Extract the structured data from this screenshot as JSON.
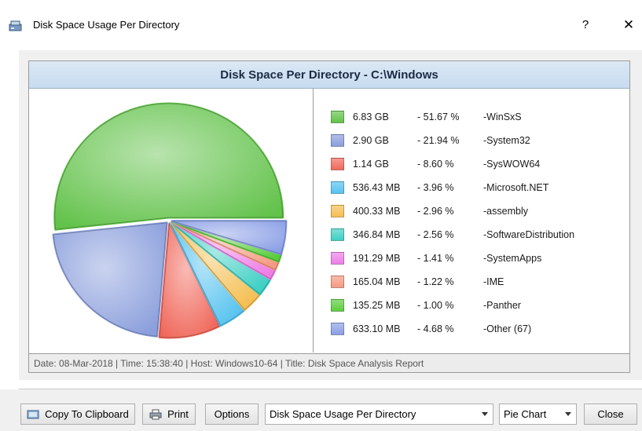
{
  "window": {
    "title": "Disk Space Usage Per Directory",
    "help_label": "?",
    "close_label": "✕"
  },
  "report": {
    "title": "Disk Space Per Directory - C:\\Windows",
    "footer": "Date: 08-Mar-2018 | Time: 15:38:40 | Host: Windows10-64 | Title: Disk Space Analysis Report"
  },
  "chart_data": {
    "type": "pie",
    "title": "Disk Space Per Directory - C:\\Windows",
    "slices": [
      {
        "label": "WinSxS",
        "size": "6.83 GB",
        "percent": 51.67,
        "percent_label": "- 51.67 %",
        "color": "#62c24a"
      },
      {
        "label": "System32",
        "size": "2.90 GB",
        "percent": 21.94,
        "percent_label": "- 21.94 %",
        "color": "#8a9edc"
      },
      {
        "label": "SysWOW64",
        "size": "1.14 GB",
        "percent": 8.6,
        "percent_label": "- 8.60 %",
        "color": "#f0675a"
      },
      {
        "label": "Microsoft.NET",
        "size": "536.43 MB",
        "percent": 3.96,
        "percent_label": "- 3.96 %",
        "color": "#55c2ef"
      },
      {
        "label": "assembly",
        "size": "400.33 MB",
        "percent": 2.96,
        "percent_label": "- 2.96 %",
        "color": "#f5be52"
      },
      {
        "label": "SoftwareDistribution",
        "size": "346.84 MB",
        "percent": 2.56,
        "percent_label": "- 2.56 %",
        "color": "#3ecfc4"
      },
      {
        "label": "SystemApps",
        "size": "191.29 MB",
        "percent": 1.41,
        "percent_label": "- 1.41 %",
        "color": "#ee7ee6"
      },
      {
        "label": "IME",
        "size": "165.04 MB",
        "percent": 1.22,
        "percent_label": "- 1.22 %",
        "color": "#f59a82"
      },
      {
        "label": "Panther",
        "size": "135.25 MB",
        "percent": 1.0,
        "percent_label": "- 1.00 %",
        "color": "#5ccd3e"
      },
      {
        "label": "Other (67)",
        "size": "633.10 MB",
        "percent": 4.68,
        "percent_label": "- 4.68 %",
        "color": "#8a9ee6"
      }
    ]
  },
  "buttons": {
    "copy": "Copy To Clipboard",
    "print": "Print",
    "options": "Options",
    "close": "Close"
  },
  "combos": {
    "report_type": "Disk Space Usage Per Directory",
    "chart_type": "Pie Chart"
  }
}
